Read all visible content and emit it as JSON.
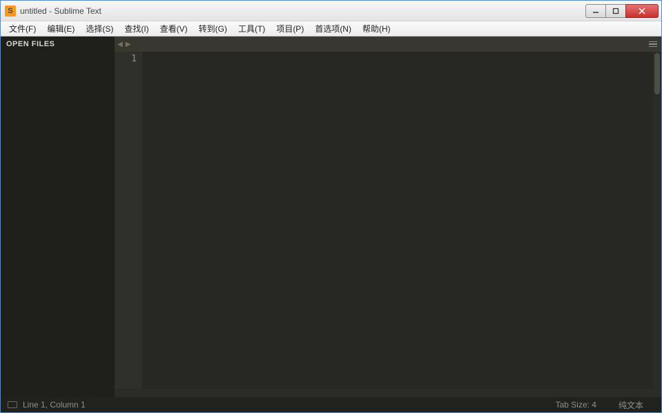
{
  "window": {
    "title": "untitled - Sublime Text"
  },
  "menu": {
    "items": [
      "文件(F)",
      "编辑(E)",
      "选择(S)",
      "查找(I)",
      "查看(V)",
      "转到(G)",
      "工具(T)",
      "项目(P)",
      "首选项(N)",
      "帮助(H)"
    ]
  },
  "sidebar": {
    "header": "OPEN FILES"
  },
  "editor": {
    "line_number": "1"
  },
  "status": {
    "position": "Line 1, Column 1",
    "tab_size": "Tab Size: 4",
    "syntax": "纯文本"
  }
}
